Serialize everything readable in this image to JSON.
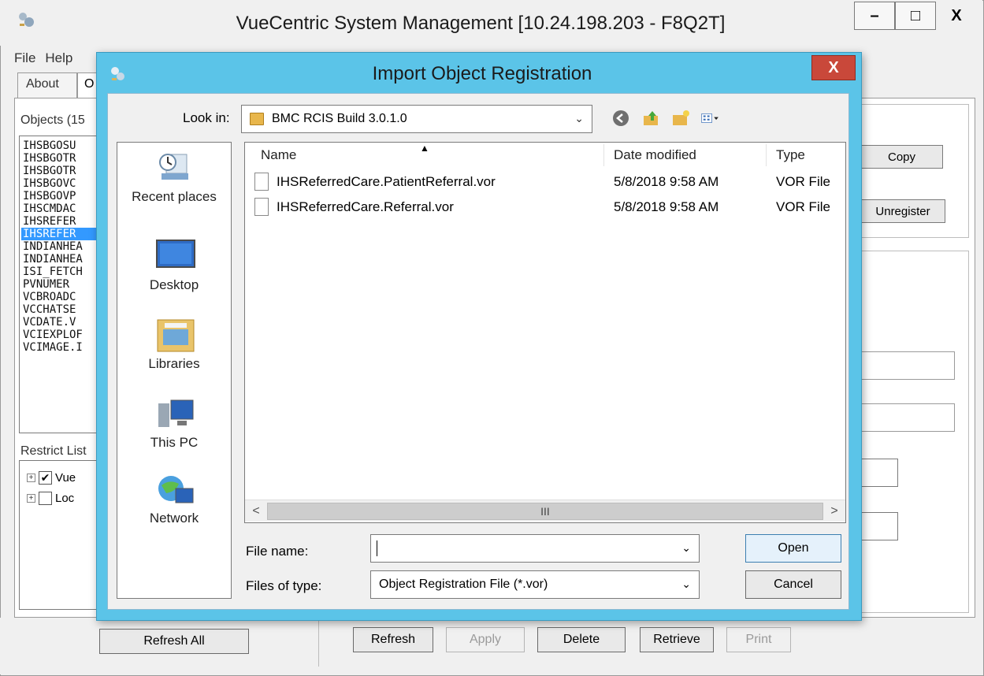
{
  "main": {
    "title": "VueCentric System Management  [10.24.198.203 - F8Q2T]",
    "minimize": "–",
    "maximize": "□",
    "close": "X",
    "menu": [
      "File",
      "Help"
    ],
    "tabs": [
      "About",
      "O"
    ],
    "objects_label": "Objects (15",
    "objects": [
      "IHSBGOSU",
      "IHSBGOTR",
      "IHSBGOTR",
      "IHSBGOVC",
      "IHSBGOVP",
      "IHSCMDAC",
      "IHSREFER",
      "IHSREFER",
      "INDIANHEA",
      "INDIANHEA",
      "ISI_FETCH",
      "PVNUMER",
      "VCBROADC",
      "VCCHATSE",
      "VCDATE.V",
      "VCIEXPLOF",
      "VCIMAGE.I"
    ],
    "selected_index": 7,
    "restrict_label": "Restrict List",
    "tree": [
      {
        "label": "Vue",
        "checked": "✔"
      },
      {
        "label": "Loc",
        "checked": ""
      }
    ],
    "copy_button": "Copy",
    "unregister_button": "Unregister",
    "bottom": {
      "refresh_all": "Refresh All",
      "refresh": "Refresh",
      "apply": "Apply",
      "delete": "Delete",
      "retrieve": "Retrieve",
      "print": "Print"
    }
  },
  "dialog": {
    "title": "Import Object Registration",
    "close": "X",
    "look_in_label": "Look in:",
    "look_in_value": "BMC RCIS Build 3.0.1.0",
    "places": [
      "Recent places",
      "Desktop",
      "Libraries",
      "This PC",
      "Network"
    ],
    "columns": [
      "Name",
      "Date modified",
      "Type"
    ],
    "files": [
      {
        "name": "IHSReferredCare.PatientReferral.vor",
        "date": "5/8/2018 9:58 AM",
        "type": "VOR File"
      },
      {
        "name": "IHSReferredCare.Referral.vor",
        "date": "5/8/2018 9:58 AM",
        "type": "VOR File"
      }
    ],
    "scroll_thumb": "III",
    "file_name_label": "File name:",
    "file_name_value": "",
    "files_of_type_label": "Files of type:",
    "files_of_type_value": "Object Registration File (*.vor)",
    "open_button": "Open",
    "cancel_button": "Cancel"
  }
}
